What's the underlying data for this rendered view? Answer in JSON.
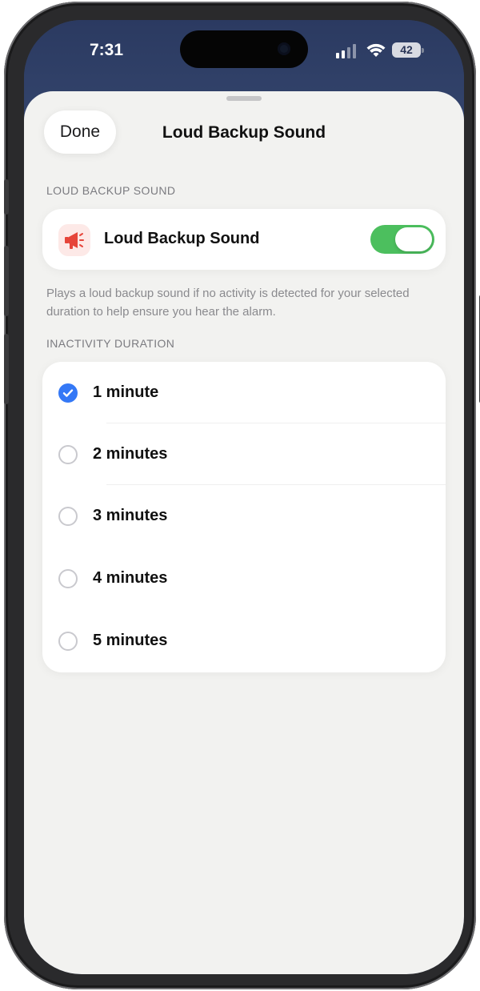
{
  "status_bar": {
    "time": "7:31",
    "battery": "42"
  },
  "sheet": {
    "done_label": "Done",
    "title": "Loud Backup Sound",
    "section_label": "LOUD BACKUP SOUND",
    "toggle": {
      "label": "Loud Backup Sound",
      "enabled": true,
      "icon": "megaphone-icon",
      "accent_color": "#e6453a",
      "on_color": "#4cbf5e"
    },
    "description": "Plays a loud backup sound if no activity is detected for your selected duration to help ensure you hear the alarm.",
    "duration_label": "INACTIVITY DURATION",
    "options": [
      {
        "label": "1 minute",
        "selected": true
      },
      {
        "label": "2 minutes",
        "selected": false
      },
      {
        "label": "3 minutes",
        "selected": false
      },
      {
        "label": "4 minutes",
        "selected": false
      },
      {
        "label": "5 minutes",
        "selected": false
      }
    ],
    "selected_color": "#3478f6"
  }
}
